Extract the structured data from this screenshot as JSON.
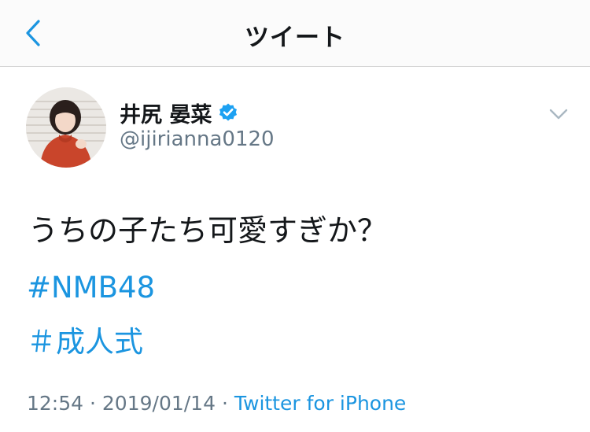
{
  "nav": {
    "back_icon": "chevron-left-icon",
    "title": "ツイート"
  },
  "tweet": {
    "author": {
      "display_name": "井尻 晏菜",
      "verified": true,
      "handle": "@ijirianna0120"
    },
    "text": "うちの子たち可愛すぎか？",
    "hashtags": [
      "#NMB48",
      "＃成人式"
    ],
    "time": "12:54",
    "separator": "·",
    "date": "2019/01/14",
    "source": "Twitter for iPhone"
  },
  "colors": {
    "link": "#1b95e0",
    "secondary_text": "#657786",
    "primary_text": "#14171a",
    "verified_badge": "#1da1f2"
  }
}
